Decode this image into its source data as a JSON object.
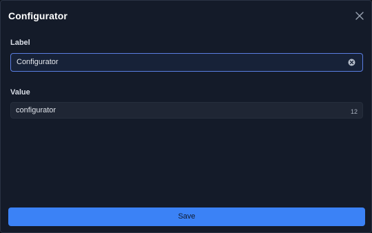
{
  "dialog": {
    "title": "Configurator",
    "close_icon": "close-icon"
  },
  "fields": {
    "label": {
      "label": "Label",
      "value": "Configurator",
      "clear_icon": "clear-circle-icon"
    },
    "value": {
      "label": "Value",
      "value": "configurator",
      "char_count": "12"
    }
  },
  "actions": {
    "save_label": "Save"
  },
  "colors": {
    "background": "#141b29",
    "accent": "#3b82f6",
    "focus_border": "#5b7fe3"
  }
}
